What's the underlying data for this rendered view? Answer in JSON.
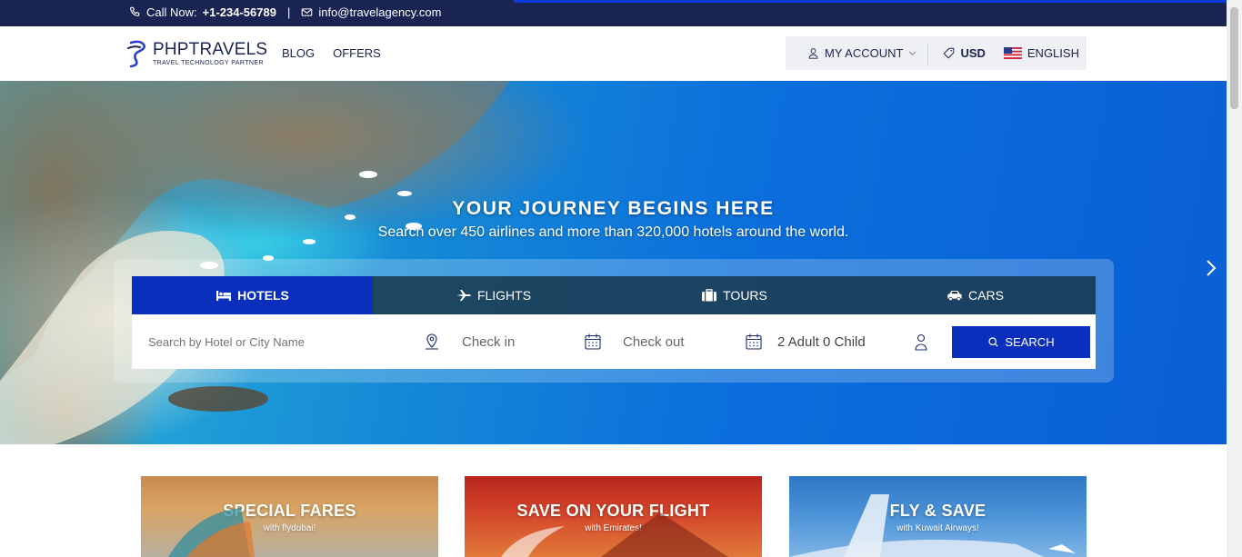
{
  "topbar": {
    "call_label": "Call Now:",
    "phone": "+1-234-56789",
    "separator": "|",
    "email": "info@travelagency.com"
  },
  "header": {
    "logo_main": "PHPTRAVELS",
    "logo_sub": "TRAVEL TECHNOLOGY PARTNER",
    "nav": [
      "BLOG",
      "OFFERS"
    ],
    "account_label": "MY ACCOUNT",
    "currency": "USD",
    "language": "ENGLISH"
  },
  "hero": {
    "title": "YOUR JOURNEY BEGINS HERE",
    "subtitle": "Search over 450 airlines and more than 320,000 hotels around the world."
  },
  "search": {
    "tabs": [
      {
        "label": "HOTELS",
        "icon": "bed-icon",
        "active": true
      },
      {
        "label": "FLIGHTS",
        "icon": "plane-icon",
        "active": false
      },
      {
        "label": "TOURS",
        "icon": "suitcase-icon",
        "active": false
      },
      {
        "label": "CARS",
        "icon": "car-icon",
        "active": false
      }
    ],
    "destination_placeholder": "Search by Hotel or City Name",
    "checkin_placeholder": "Check in",
    "checkout_placeholder": "Check out",
    "guests": "2 Adult 0 Child",
    "button_label": "SEARCH"
  },
  "promos": [
    {
      "title": "SPECIAL FARES",
      "subtitle": "with flydubai!"
    },
    {
      "title": "SAVE ON YOUR FLIGHT",
      "subtitle": "with Emirates!"
    },
    {
      "title": "FLY & SAVE",
      "subtitle": "with Kuwait Airways!"
    }
  ],
  "colors": {
    "navy": "#1a2452",
    "accent_blue": "#0a2fbd",
    "tab_dark": "#143246"
  }
}
